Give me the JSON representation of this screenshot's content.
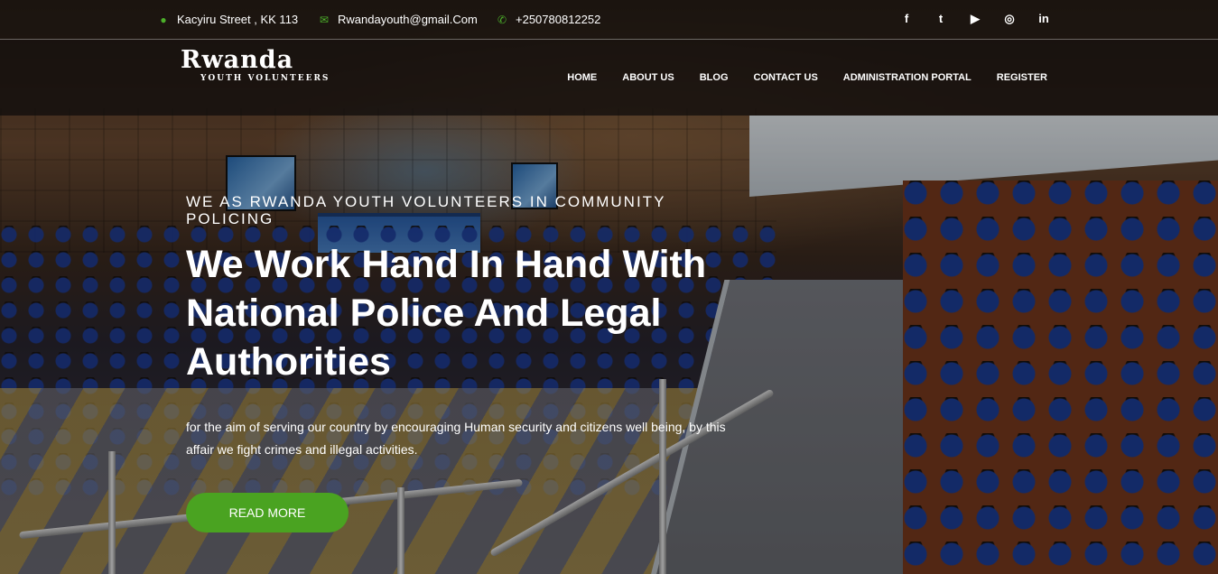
{
  "topbar": {
    "address": {
      "icon": "map-marker-icon",
      "text": "Kacyiru Street , KK 113"
    },
    "email": {
      "icon": "envelope-icon",
      "text": "Rwandayouth@gmail.Com"
    },
    "phone": {
      "icon": "phone-icon",
      "text": "+250780812252"
    },
    "socials": [
      {
        "name": "facebook-icon",
        "glyph": "f"
      },
      {
        "name": "twitter-icon",
        "glyph": "t"
      },
      {
        "name": "youtube-icon",
        "glyph": "▶"
      },
      {
        "name": "dribbble-icon",
        "glyph": "◎"
      },
      {
        "name": "linkedin-icon",
        "glyph": "in"
      }
    ]
  },
  "brand": {
    "title": "Rwanda",
    "subtitle": "YOUTH VOLUNTEERS"
  },
  "nav": {
    "items": [
      "HOME",
      "ABOUT US",
      "BLOG",
      "CONTACT US",
      "ADMINISTRATION PORTAL",
      "REGISTER"
    ]
  },
  "hero": {
    "kicker": "WE AS RWANDA YOUTH VOLUNTEERS IN COMMUNITY POLICING",
    "headline": "We Work Hand In Hand With National Police And Legal Authorities",
    "description": "for the aim of serving our country by encouraging Human security and citizens well being, by this affair we fight crimes and illegal activities.",
    "cta_label": "READ MORE"
  },
  "colors": {
    "accent": "#4aa321",
    "icon_green": "#4caf2a",
    "text": "#ffffff"
  }
}
